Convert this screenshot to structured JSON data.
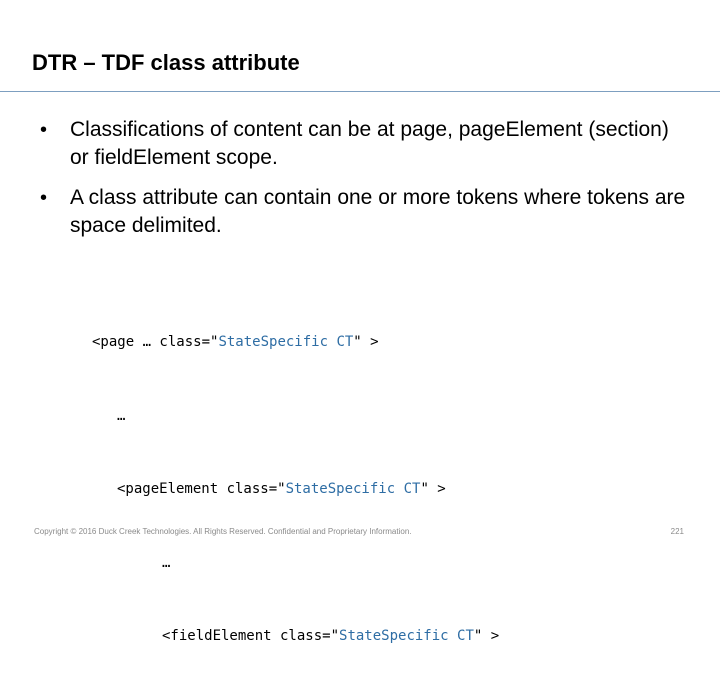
{
  "slide": {
    "title": "DTR – TDF class attribute",
    "bullets": [
      "Classifications of content can be at page, pageElement (section) or fieldElement scope.",
      "A class attribute can contain one or more tokens where tokens are space delimited."
    ],
    "bullet_symbol": "•"
  },
  "code": {
    "line1_prefix": "<page … class=\"",
    "line1_value": "StateSpecific CT",
    "line1_suffix": "\" >",
    "line2": "…",
    "line3_prefix": "<pageElement class=\"",
    "line3_value": "StateSpecific CT",
    "line3_suffix": "\" >",
    "line4": "…",
    "line5_prefix": "<fieldElement class=\"",
    "line5_value": "StateSpecific CT",
    "line5_suffix": "\" >"
  },
  "footer": {
    "copyright": "Copyright © 2016 Duck Creek Technologies. All Rights Reserved. Confidential and Proprietary Information.",
    "page_number": "221"
  },
  "colors": {
    "title_rule": "#7d9fc0",
    "attribute_value": "#2e6da4",
    "footer_text": "#8a8a8a"
  }
}
